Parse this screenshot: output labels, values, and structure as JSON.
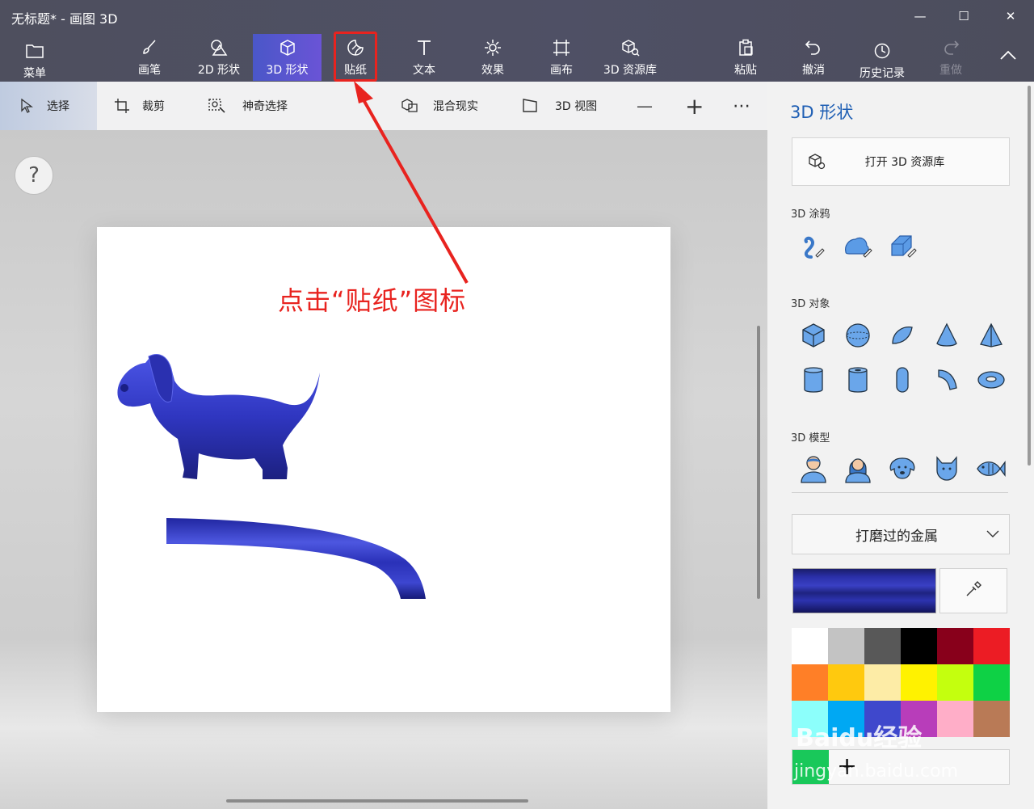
{
  "window": {
    "title": "无标题* - 画图 3D",
    "minimize": "—",
    "maximize": "☐",
    "close": "✕"
  },
  "toolbar": {
    "menu": "菜单",
    "brushes": "画笔",
    "shapes2d": "2D 形状",
    "shapes3d": "3D 形状",
    "stickers": "贴纸",
    "text": "文本",
    "effects": "效果",
    "canvas": "画布",
    "library3d": "3D 资源库",
    "paste": "粘贴",
    "undo": "撤消",
    "history": "历史记录",
    "redo": "重做"
  },
  "subbar": {
    "select": "选择",
    "crop": "裁剪",
    "magic_select": "神奇选择",
    "mixed_reality": "混合现实",
    "view3d": "3D 视图",
    "zoom_out": "—",
    "zoom_in": "+",
    "more": "⋯"
  },
  "help": "?",
  "annotation": "点击“贴纸”图标",
  "panel": {
    "title": "3D 形状",
    "open_library": "打开 3D 资源库",
    "doodle_label": "3D 涂鸦",
    "objects_label": "3D 对象",
    "models_label": "3D 模型",
    "material": "打磨过的金属",
    "palette": [
      "#ffffff",
      "#c3c3c3",
      "#585858",
      "#000000",
      "#88001b",
      "#ec1c24",
      "#ff7f27",
      "#ffc90e",
      "#fdeca6",
      "#fff200",
      "#c4ff0e",
      "#0ed145",
      "#8cfffb",
      "#00a8f3",
      "#3f48cc",
      "#b83dba",
      "#ffaec8",
      "#b97a56"
    ],
    "custom_color": "#19c85a",
    "current_color": "#2a2fa8"
  },
  "watermark": {
    "brand": "Baidu经验",
    "url": "jingyan.baidu.com"
  }
}
